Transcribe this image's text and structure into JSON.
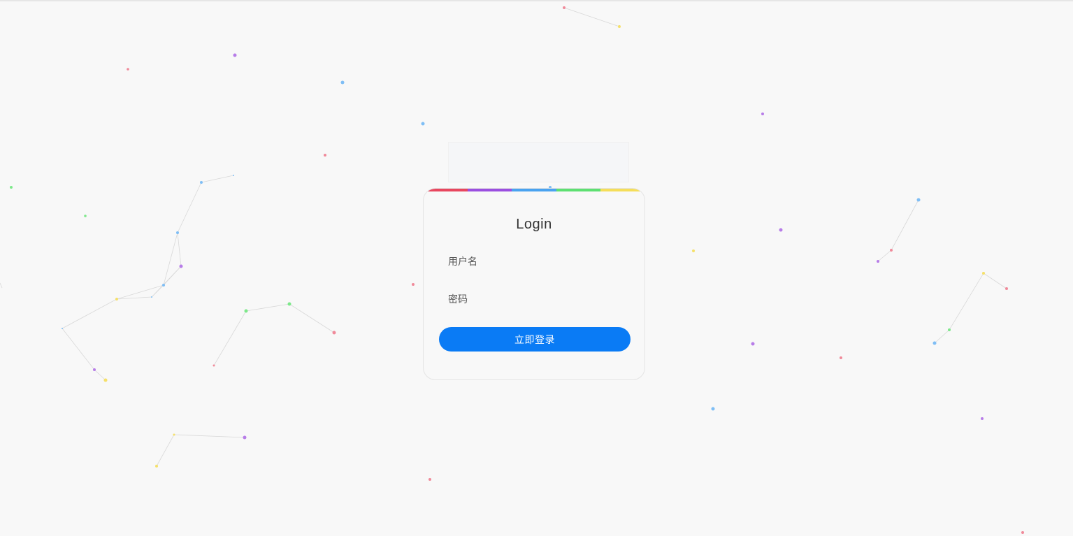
{
  "login": {
    "title": "Login",
    "username_placeholder": "用户名",
    "password_placeholder": "密码",
    "submit_label": "立即登录"
  },
  "colors": {
    "background": "#f8f8f8",
    "button": "#0a7bf5",
    "rainbow": [
      "#e8475f",
      "#9b4fe0",
      "#4aa3f0",
      "#5ee072",
      "#f5de5a"
    ],
    "particles": [
      "#f08a9a",
      "#b77de8",
      "#7fbef5",
      "#7de88a",
      "#f5e06a"
    ]
  }
}
